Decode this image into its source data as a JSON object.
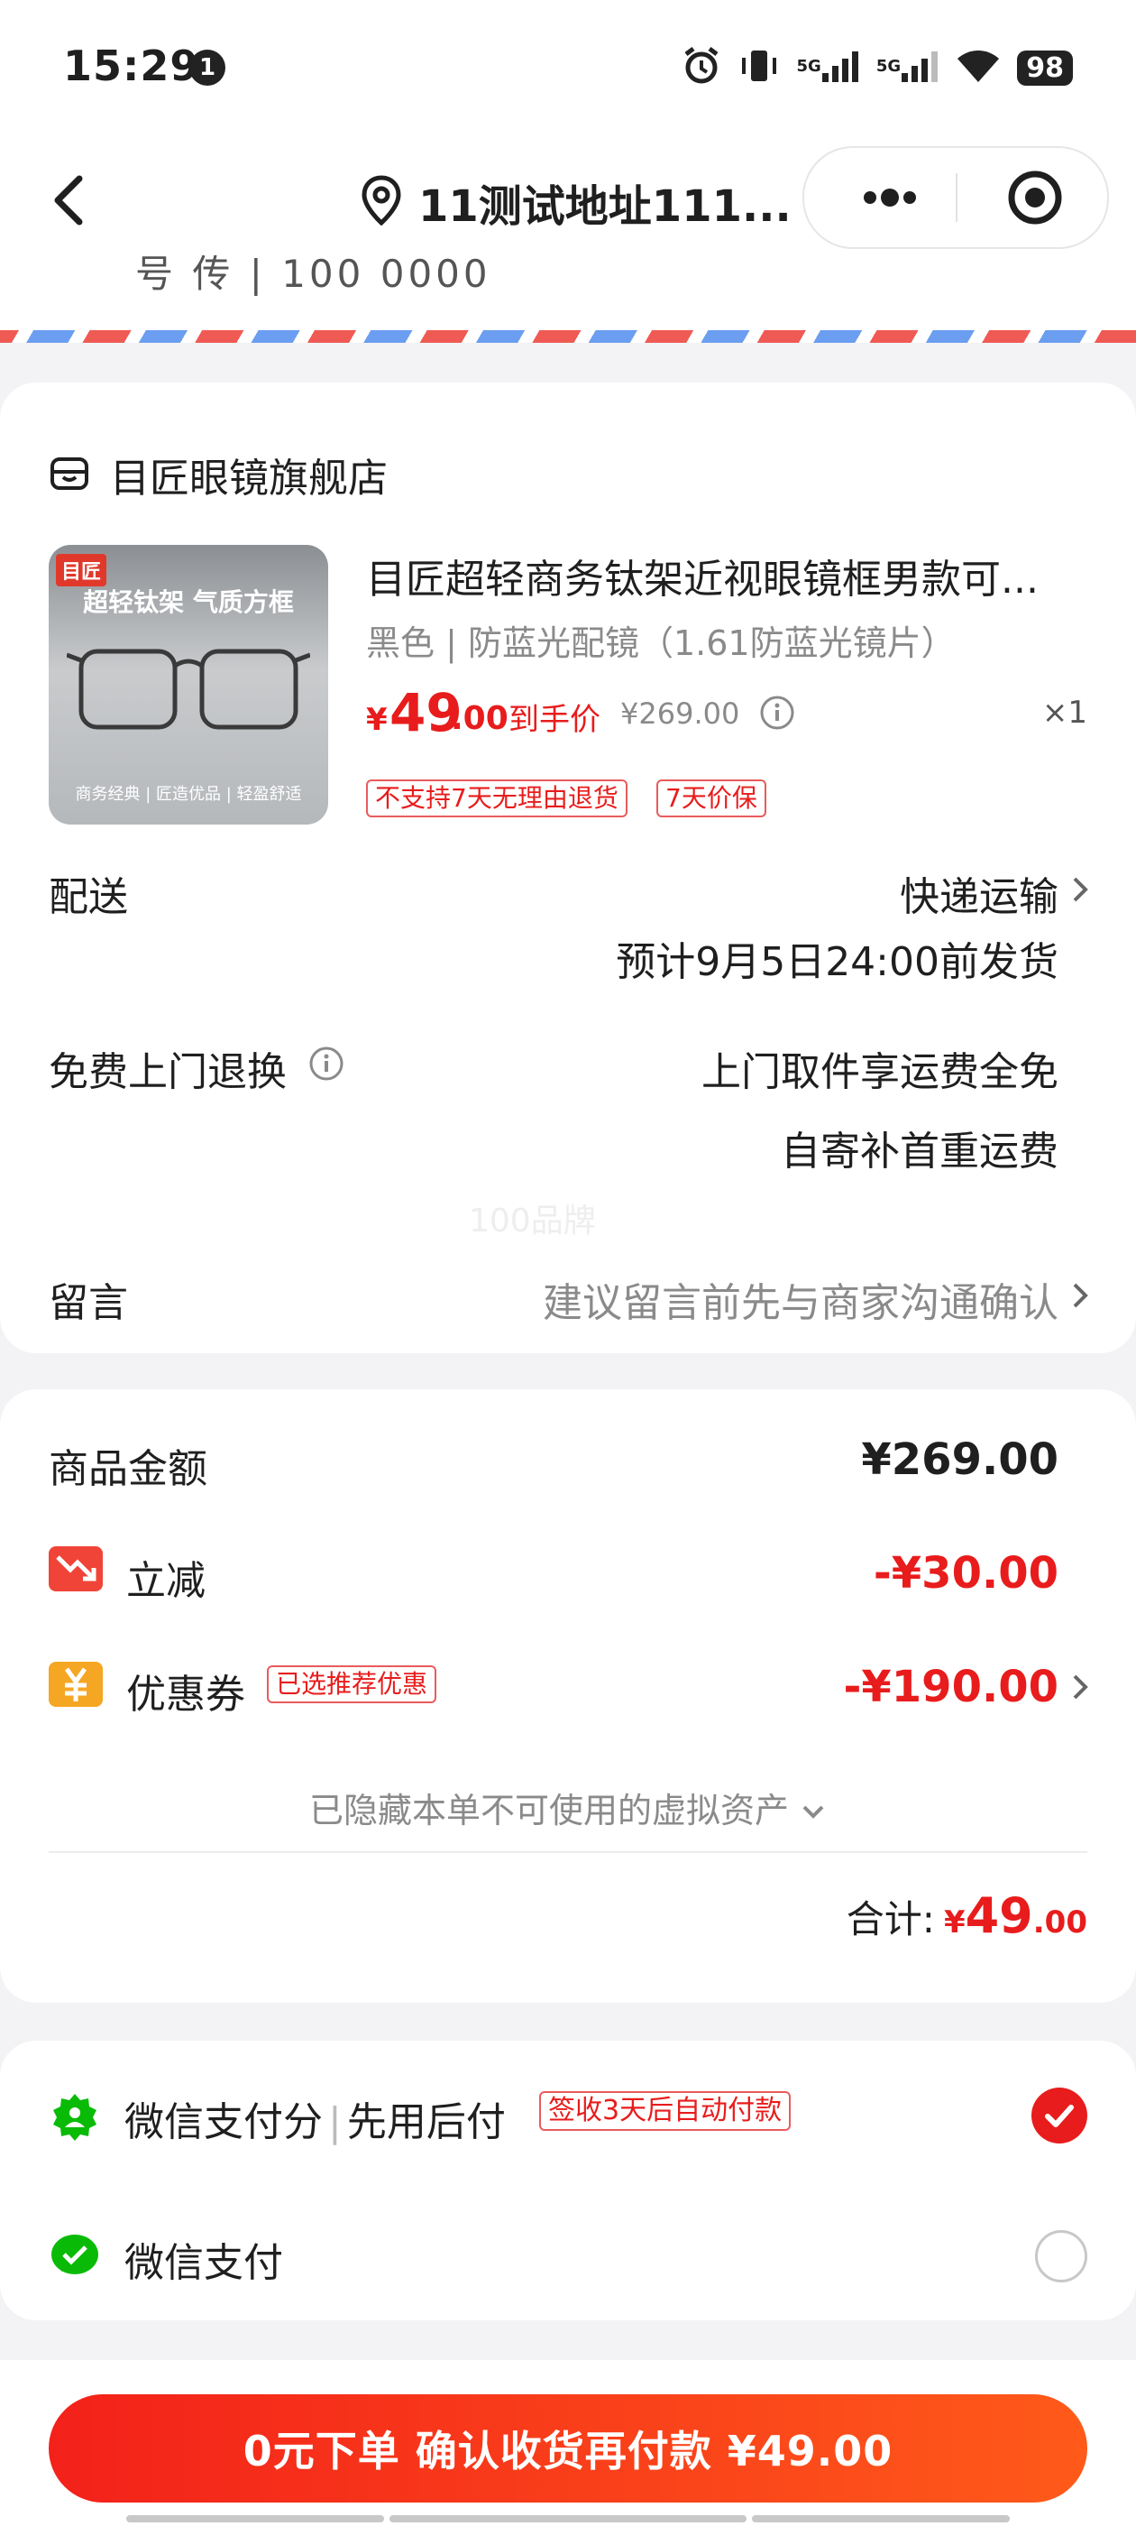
{
  "status_bar": {
    "time": "15:29",
    "notification_count": "1",
    "network_1": "5G",
    "network_2": "5G",
    "battery": "98"
  },
  "nav": {
    "address": "11测试地址111..."
  },
  "address_cut": "号 传 | 100  0000",
  "shop": {
    "name": "目匠眼镜旗舰店"
  },
  "product": {
    "image": {
      "badge": "目匠",
      "slogan": "超轻钛架 气质方框",
      "footer": "商务经典 | 匠造优品 | 轻盈舒适"
    },
    "title": "目匠超轻商务钛架近视眼镜框男款可...",
    "spec": "黑色 | 防蓝光配镜（1.61防蓝光镜片）",
    "price_currency": "¥",
    "price_int": "49",
    "price_dec": ".00",
    "final_price_label": "到手价",
    "original_price": "¥269.00",
    "quantity": "×1",
    "tags": [
      "不支持7天无理由退货",
      "7天价保"
    ]
  },
  "delivery": {
    "label": "配送",
    "method": "快递运输",
    "eta": "预计9月5日24:00前发货"
  },
  "returns": {
    "label": "免费上门退换",
    "line1": "上门取件享运费全免",
    "line2": "自寄补首重运费"
  },
  "watermark": "100品牌",
  "message": {
    "label": "留言",
    "placeholder": "建议留言前先与商家沟通确认"
  },
  "summary": {
    "goods_label": "商品金额",
    "goods_amount": "¥269.00",
    "discount_label": "立减",
    "discount_amount": "-¥30.00",
    "coupon_label": "优惠券",
    "coupon_tag": "已选推荐优惠",
    "coupon_amount": "-¥190.00",
    "hidden_assets": "已隐藏本单不可使用的虚拟资产",
    "total_label": "合计:",
    "total_currency": "¥",
    "total_int": "49",
    "total_dec": ".00"
  },
  "payment": {
    "option1_label": "微信支付分",
    "option1_sub": "先用后付",
    "option1_tag": "签收3天后自动付款",
    "option1_selected": true,
    "option2_label": "微信支付",
    "option2_selected": false
  },
  "submit": {
    "label": "0元下单 确认收货再付款 ¥49.00"
  },
  "colors": {
    "accent": "#e81c1c",
    "wechat_green": "#09bb07",
    "coupon_orange": "#f5a623"
  }
}
